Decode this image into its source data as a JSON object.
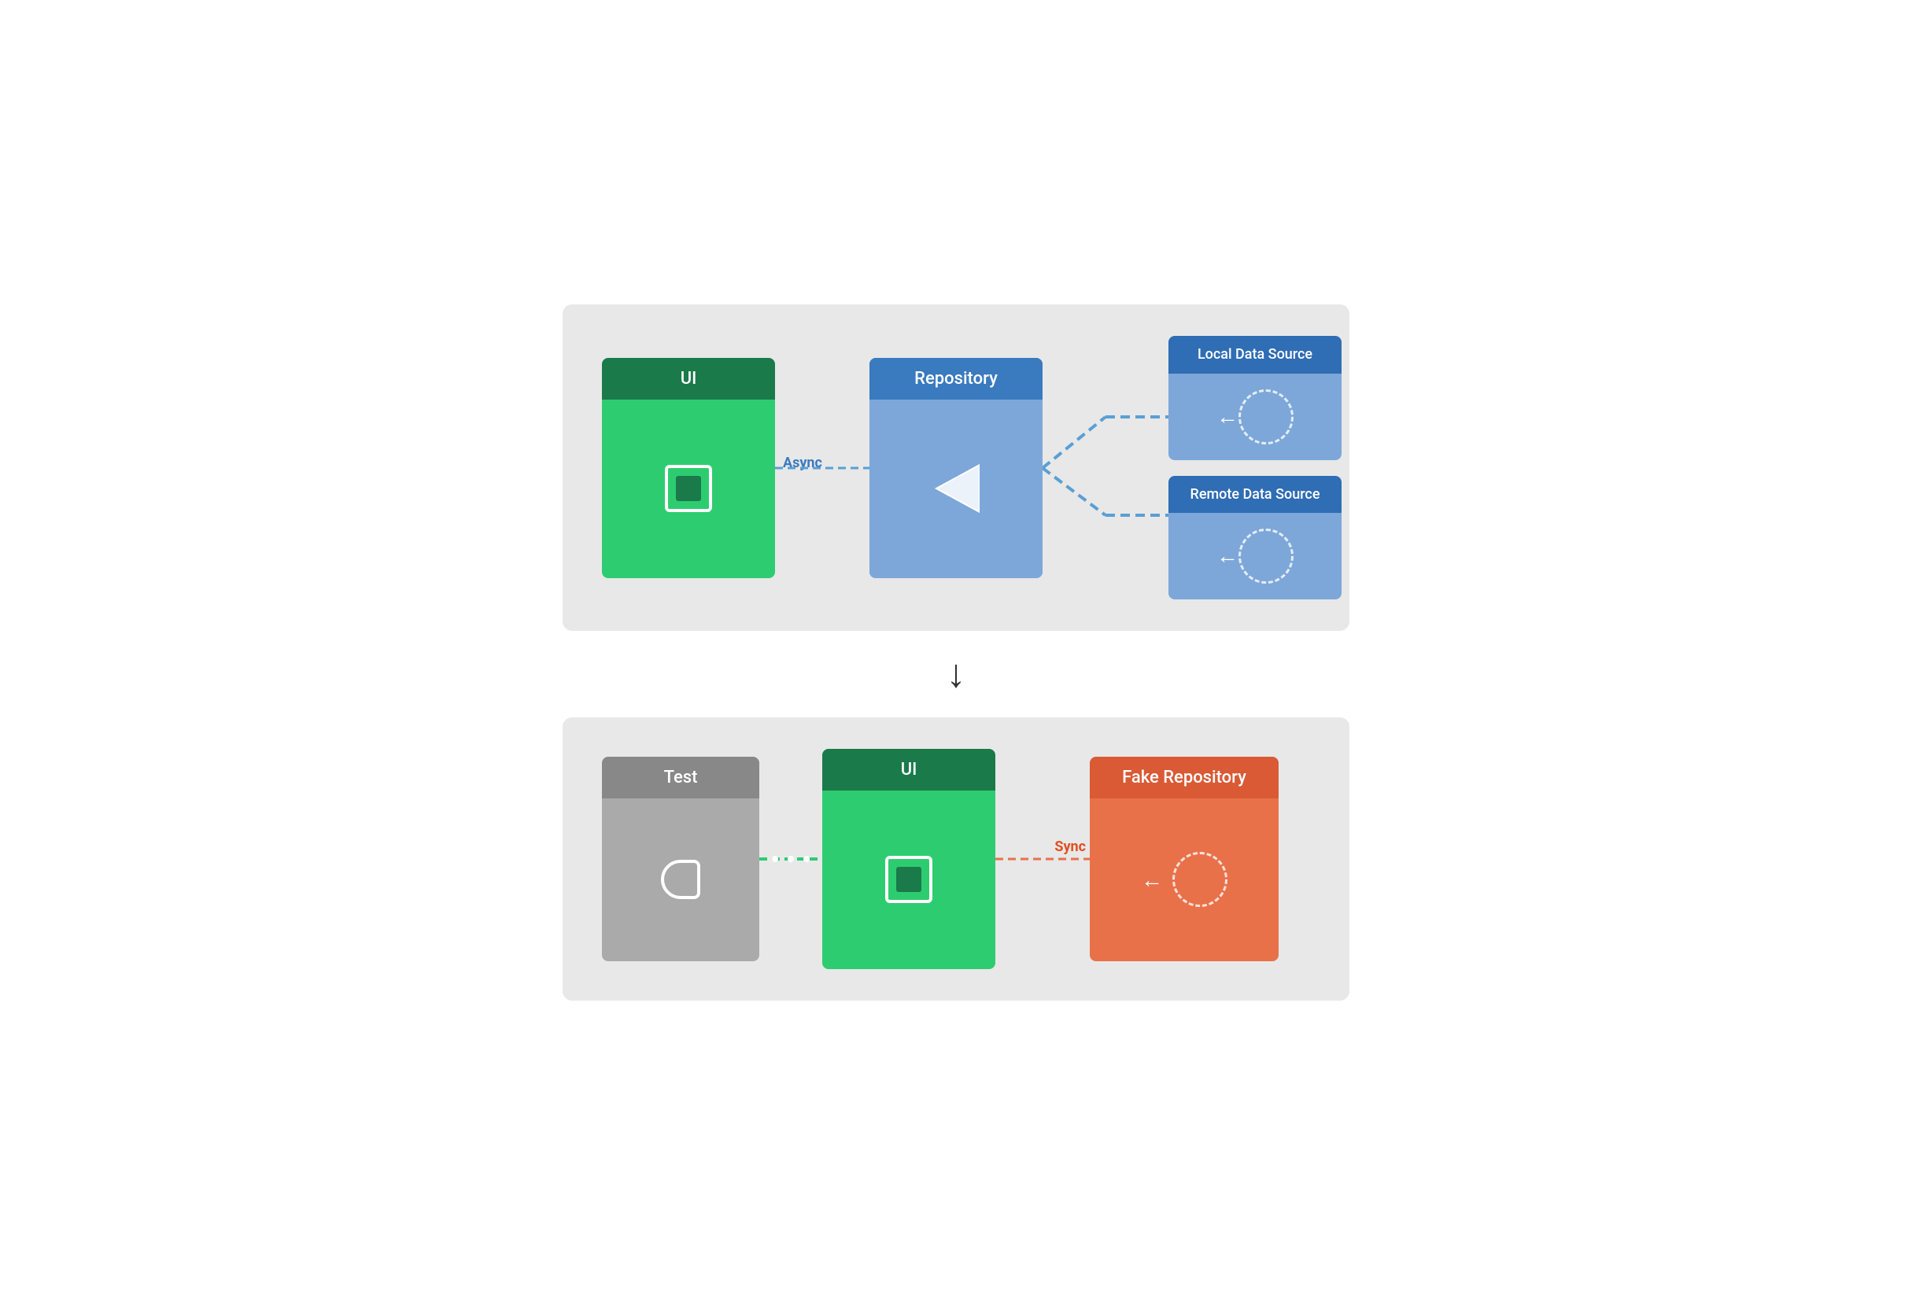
{
  "top_diagram": {
    "ui_label": "UI",
    "repo_label": "Repository",
    "async_label": "Async",
    "local_source_label": "Local Data Source",
    "remote_source_label": "Remote Data Source"
  },
  "arrow": "↓",
  "bottom_diagram": {
    "test_label": "Test",
    "ui_label": "UI",
    "fake_repo_label": "Fake Repository",
    "sync_label": "Sync"
  }
}
